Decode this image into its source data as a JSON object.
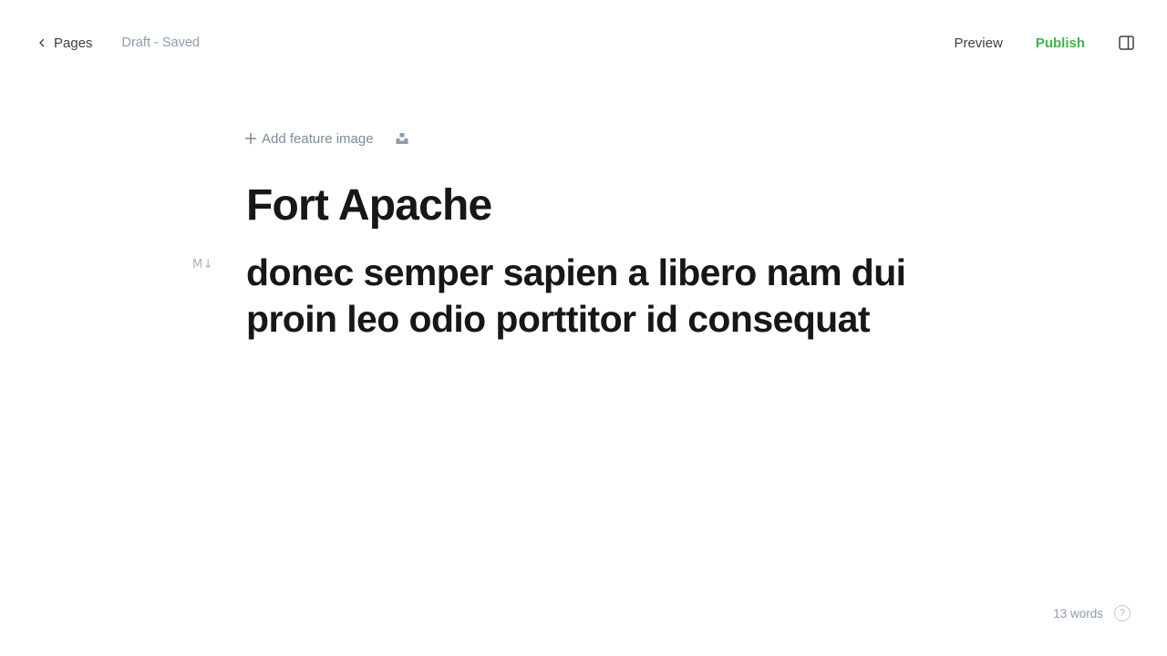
{
  "header": {
    "back_label": "Pages",
    "status": "Draft - Saved",
    "preview_label": "Preview",
    "publish_label": "Publish"
  },
  "editor": {
    "add_feature_image_label": "Add feature image",
    "title": "Fort Apache",
    "markdown_indicator": "M↓",
    "body": "donec semper sapien a libero nam dui proin leo odio porttitor id consequat"
  },
  "footer": {
    "word_count": "13 words",
    "help_label": "?"
  },
  "colors": {
    "publish": "#3eb64a",
    "muted_text": "#8e9cac",
    "text": "#15171a"
  },
  "icons": {
    "back": "chevron-left-icon",
    "sidebar": "sidebar-toggle-icon",
    "add": "plus-icon",
    "unsplash": "unsplash-icon",
    "help": "question-circle-icon"
  }
}
